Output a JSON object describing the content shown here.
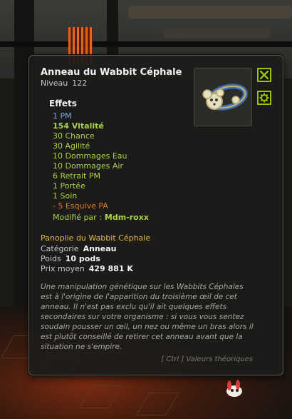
{
  "tooltip": {
    "title": "Anneau du Wabbit Céphale",
    "level_label": "Niveau",
    "level_value": "122",
    "effects_heading": "Effets",
    "effects": [
      {
        "text": "1 PM",
        "tone": "blue"
      },
      {
        "text": "154 Vitalité",
        "tone": "green-bold"
      },
      {
        "text": "30 Chance",
        "tone": "green"
      },
      {
        "text": "30 Agilité",
        "tone": "green"
      },
      {
        "text": "10 Dommages Eau",
        "tone": "green"
      },
      {
        "text": "10 Dommages Air",
        "tone": "green"
      },
      {
        "text": "6 Retrait PM",
        "tone": "green"
      },
      {
        "text": "1 Portée",
        "tone": "green"
      },
      {
        "text": "1 Soin",
        "tone": "green"
      },
      {
        "text": "- 5 Esquive PA",
        "tone": "orange"
      }
    ],
    "modified_by_label": "Modifié par :",
    "modified_by_value": "Mdm-roxx",
    "set_name": "Panoplie du Wabbit Céphale",
    "category_label": "Catégorie",
    "category_value": "Anneau",
    "weight_label": "Poids",
    "weight_value": "10 pods",
    "price_label": "Prix moyen",
    "price_value": "429 881 K",
    "description": "Une manipulation génétique sur les Wabbits Céphales est à l'origine de l'apparition du troisième œil de cet anneau. Il n'est pas exclu qu'il ait quelques effets secondaires sur votre organisme : si vous vous sentez soudain pousser un œil, un nez ou même un bras alors il est plutôt conseillé de retirer cet anneau avant que la situation ne s'empire.",
    "hint": "[ Ctrl ] Valeurs théoriques",
    "buttons": {
      "close_icon": "close-icon",
      "settings_icon": "gear-icon"
    },
    "item_icon": "ring-icon"
  },
  "colors": {
    "accent_button": "#9ac400",
    "effect_blue": "#7aa7e0",
    "effect_green": "#a8d24a",
    "effect_orange": "#e07a2a",
    "set_gold": "#e0b84a"
  }
}
